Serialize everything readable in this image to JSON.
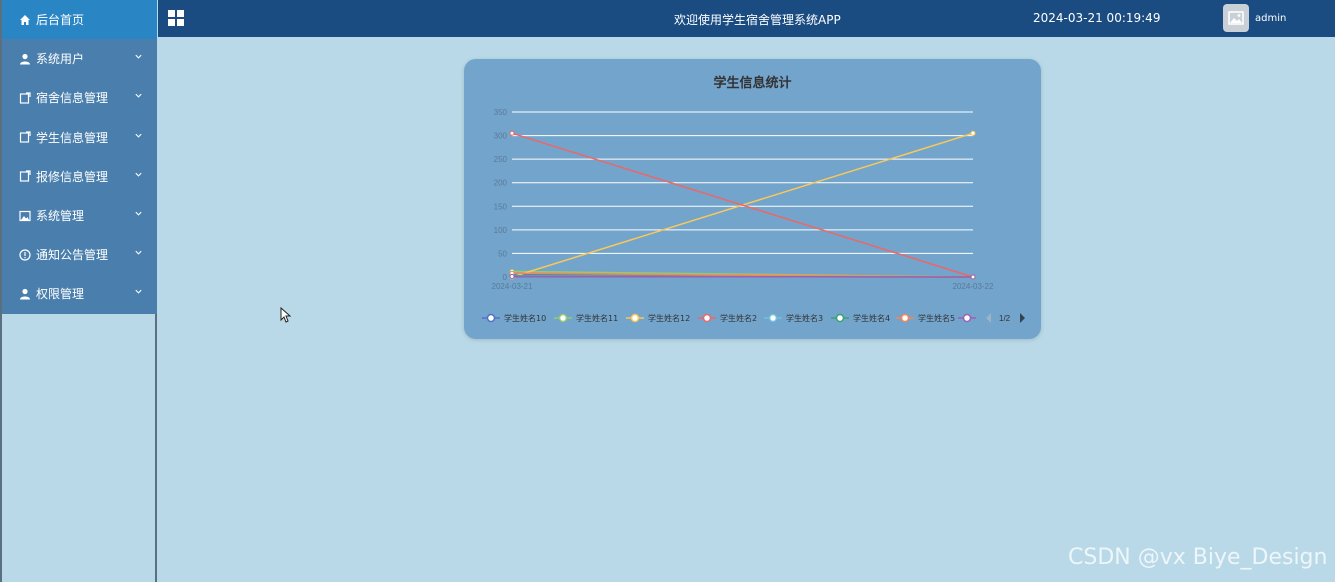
{
  "sidebar": {
    "items": [
      {
        "label": "后台首页",
        "icon": "home-icon",
        "active": true,
        "has_chevron": false
      },
      {
        "label": "系统用户",
        "icon": "user-icon",
        "active": false,
        "has_chevron": true
      },
      {
        "label": "宿舍信息管理",
        "icon": "document-icon",
        "active": false,
        "has_chevron": true
      },
      {
        "label": "学生信息管理",
        "icon": "document-icon",
        "active": false,
        "has_chevron": true
      },
      {
        "label": "报修信息管理",
        "icon": "document-icon",
        "active": false,
        "has_chevron": true
      },
      {
        "label": "系统管理",
        "icon": "image-icon",
        "active": false,
        "has_chevron": true
      },
      {
        "label": "通知公告管理",
        "icon": "info-circle-icon",
        "active": false,
        "has_chevron": true
      },
      {
        "label": "权限管理",
        "icon": "user-icon",
        "active": false,
        "has_chevron": true
      }
    ]
  },
  "header": {
    "welcome": "欢迎使用学生宿舍管理系统APP",
    "datetime": "2024-03-21 00:19:49",
    "username": "admin"
  },
  "colors": {
    "sidebar_bg": "#4a7fad",
    "active_item": "#2a85c5",
    "topbar": "#1a4c82",
    "page_bg": "#b9d9e8",
    "card_bg": "#73a4cc"
  },
  "chart_data": {
    "type": "line",
    "title": "学生信息统计",
    "x": [
      "2024-03-21",
      "2024-03-22"
    ],
    "ylim": [
      0,
      350
    ],
    "yticks": [
      0,
      50,
      100,
      150,
      200,
      250,
      300,
      350
    ],
    "grid": true,
    "legend_position": "bottom",
    "series": [
      {
        "name": "学生姓名10",
        "color": "#5470c6",
        "values": [
          5,
          0
        ]
      },
      {
        "name": "学生姓名11",
        "color": "#91cc75",
        "values": [
          12,
          0
        ]
      },
      {
        "name": "学生姓名12",
        "color": "#fac858",
        "values": [
          0,
          305
        ]
      },
      {
        "name": "学生姓名2",
        "color": "#ee6666",
        "values": [
          305,
          0
        ]
      },
      {
        "name": "学生姓名3",
        "color": "#73c0de",
        "values": [
          3,
          0
        ]
      },
      {
        "name": "学生姓名4",
        "color": "#3ba272",
        "values": [
          2,
          0
        ]
      },
      {
        "name": "学生姓名5",
        "color": "#fc8452",
        "values": [
          8,
          0
        ]
      },
      {
        "name": "",
        "color": "#9a60b4",
        "values": [
          1,
          0
        ]
      }
    ],
    "legend_pager": "1/2"
  },
  "watermark": "CSDN @vx Biye_Design"
}
